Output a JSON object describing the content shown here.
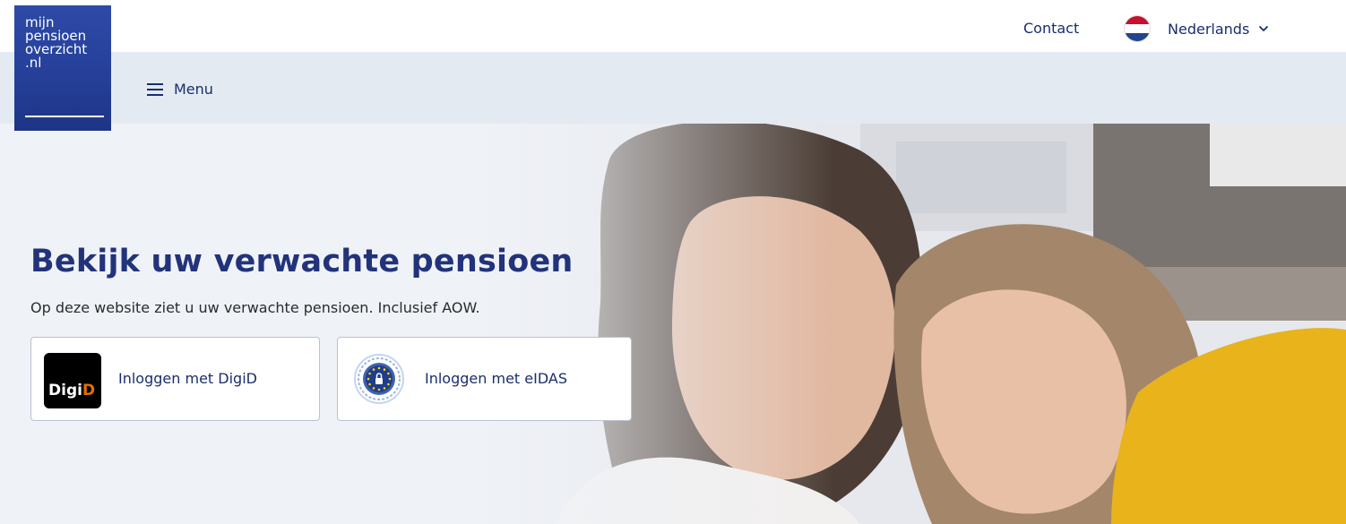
{
  "logo": {
    "lines": [
      "mijn",
      "pensioen",
      "overzicht",
      ".nl"
    ]
  },
  "header": {
    "contact_label": "Contact",
    "language_label": "Nederlands",
    "language_flag": "nl-flag-icon"
  },
  "menu": {
    "label": "Menu"
  },
  "hero": {
    "title": "Bekijk uw verwachte pensioen",
    "subtitle": "Op deze website ziet u uw verwachte pensioen. Inclusief AOW.",
    "login_digid": {
      "label": "Inloggen met DigiD",
      "logo_text_1": "Digi",
      "logo_text_2": "D"
    },
    "login_eidas": {
      "label": "Inloggen met eIDAS"
    }
  },
  "colors": {
    "brand_blue": "#26409a",
    "text_navy": "#1a2e6e",
    "title_navy": "#22337a",
    "digid_orange": "#e17000",
    "flag_red": "#c8102e",
    "flag_blue": "#21468b"
  }
}
